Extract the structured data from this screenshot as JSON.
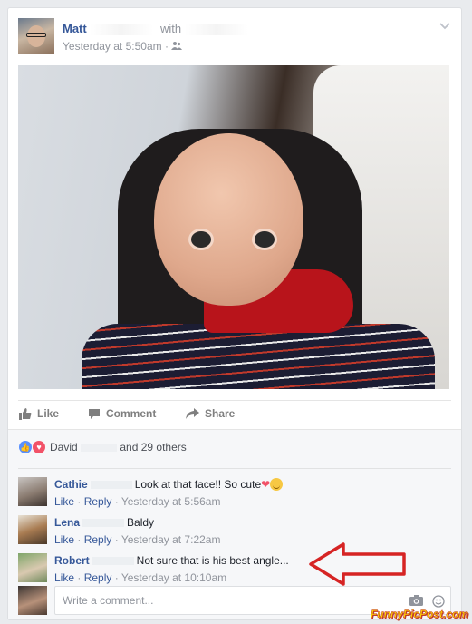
{
  "post": {
    "author": "Matt",
    "with_label": "with",
    "timestamp": "Yesterday at 5:50am",
    "separator": "·",
    "audience_icon": "friends-icon",
    "menu_icon": "chevron-down-icon"
  },
  "actions": {
    "like": "Like",
    "comment": "Comment",
    "share": "Share"
  },
  "reactions": {
    "types": [
      "like",
      "love"
    ],
    "first_name": "David",
    "rest": "and 29 others"
  },
  "comments": [
    {
      "name": "Cathie",
      "text": "Look at that face!! So cute",
      "emojis": [
        "heart",
        "smile"
      ],
      "like": "Like",
      "reply": "Reply",
      "time": "Yesterday at 5:56am"
    },
    {
      "name": "Lena",
      "text": "Baldy",
      "like": "Like",
      "reply": "Reply",
      "time": "Yesterday at 7:22am"
    },
    {
      "name": "Robert",
      "text": "Not sure that is his best angle...",
      "like": "Like",
      "reply": "Reply",
      "time": "Yesterday at 10:10am"
    }
  ],
  "composer": {
    "placeholder": "Write a comment...",
    "icons": [
      "camera-icon",
      "smiley-icon"
    ]
  },
  "watermark": "FunnyPicPost.com",
  "colors": {
    "link": "#365899",
    "meta": "#90949c",
    "arrow": "#d62424",
    "like_blue": "#5890ff",
    "love_red": "#f25268"
  }
}
